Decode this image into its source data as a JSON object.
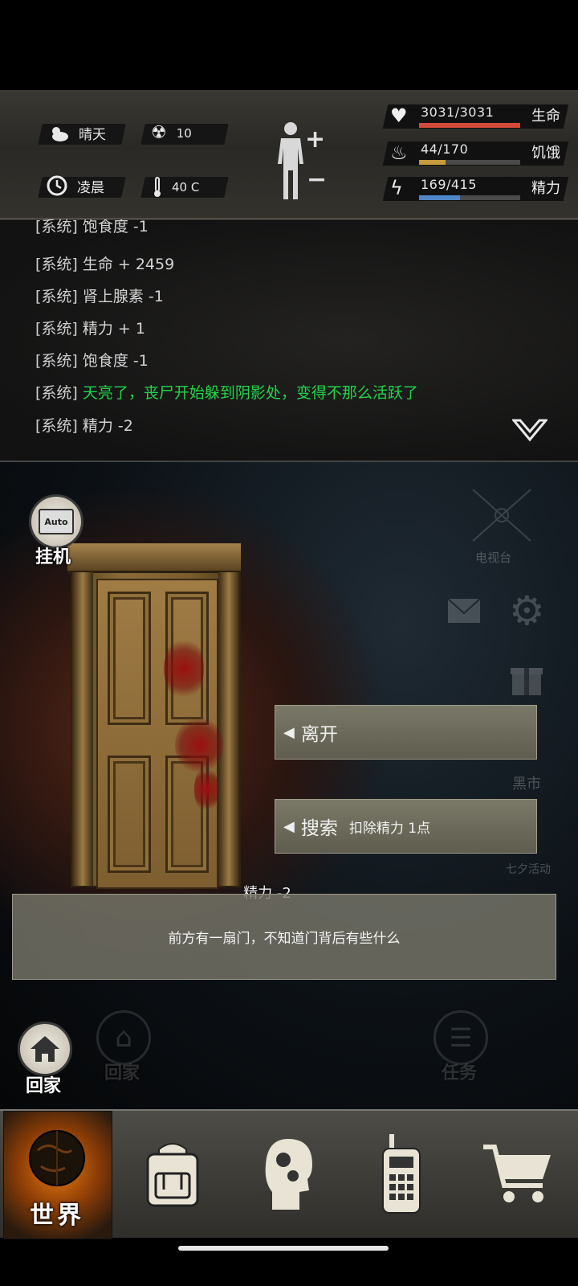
{
  "status": {
    "weather": "晴天",
    "radiation": "10",
    "time_of_day": "凌晨",
    "temperature": "40 C",
    "stats": [
      {
        "label": "生命",
        "value": "3031/3031",
        "fraction": 1.0,
        "color": "#d44a3a"
      },
      {
        "label": "饥饿",
        "value": "44/170",
        "fraction": 0.259,
        "color": "#c79a3c"
      },
      {
        "label": "精力",
        "value": "169/415",
        "fraction": 0.407,
        "color": "#4e86c9"
      }
    ]
  },
  "log": [
    {
      "tag": "[系统]",
      "msg": "饱食度 -1"
    },
    {
      "tag": "[系统]",
      "msg": "生命 + 2459"
    },
    {
      "tag": "[系统]",
      "msg": "肾上腺素 -1"
    },
    {
      "tag": "[系统]",
      "msg": "精力 + 1"
    },
    {
      "tag": "[系统]",
      "msg": "饱食度 -1"
    },
    {
      "tag": "[系统]",
      "msg": "天亮了，丧尸开始躲到阴影处，变得不那么活跃了"
    },
    {
      "tag": "[系统]",
      "msg": "精力 -2"
    }
  ],
  "scene": {
    "auto_label": "挂机",
    "auto_icon_text": "Auto",
    "side": {
      "tv": "电视台",
      "black_market": "黑市",
      "event": "七夕活动"
    },
    "actions": {
      "leave": "离开",
      "search": "搜索",
      "search_cost": "扣除精力 1点"
    },
    "effect": "精力 -2",
    "description": "前方有一扇门，不知道门背后有些什么",
    "home_label": "回家",
    "ghost_home_label": "回家",
    "ghost_task_label": "任务"
  },
  "nav": {
    "world": "世界"
  },
  "icons": [
    "weather-icon",
    "radiation-icon",
    "clock-icon",
    "thermometer-icon",
    "body-icon",
    "heart-icon",
    "stomach-icon",
    "energy-icon",
    "collapse-log-icon",
    "mail-icon",
    "settings-icon",
    "gift-icon",
    "backpack-icon",
    "skills-icon",
    "radio-icon",
    "cart-icon",
    "home-icon"
  ]
}
